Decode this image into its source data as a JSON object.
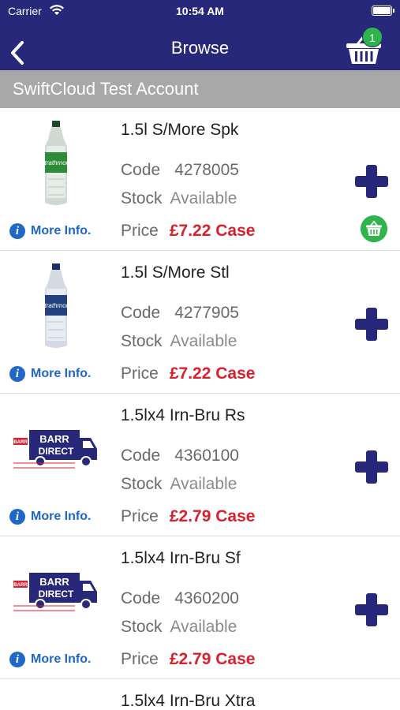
{
  "status_bar": {
    "carrier": "Carrier",
    "time": "10:54 AM"
  },
  "nav": {
    "title": "Browse",
    "basket_count": "1"
  },
  "account": {
    "name": "SwiftCloud Test Account"
  },
  "labels": {
    "code": "Code",
    "stock": "Stock",
    "price": "Price",
    "more_info": "More Info."
  },
  "products": [
    {
      "name": "1.5l S/More Spk",
      "code": "4278005",
      "stock": "Available",
      "price": "£7.22 Case",
      "image": "sparkling-water-bottle",
      "in_basket": true
    },
    {
      "name": "1.5l S/More Stl",
      "code": "4277905",
      "stock": "Available",
      "price": "£7.22 Case",
      "image": "still-water-bottle",
      "in_basket": false
    },
    {
      "name": "1.5lx4 Irn-Bru Rs",
      "code": "4360100",
      "stock": "Available",
      "price": "£2.79 Case",
      "image": "barr-direct-van-logo",
      "in_basket": false
    },
    {
      "name": "1.5lx4 Irn-Bru Sf",
      "code": "4360200",
      "stock": "Available",
      "price": "£2.79 Case",
      "image": "barr-direct-van-logo",
      "in_basket": false
    },
    {
      "name": "1.5lx4 Irn-Bru Xtra"
    }
  ],
  "colors": {
    "nav_background": "#27287a",
    "account_bar": "#a8a8a8",
    "price_red": "#d9202f",
    "link_blue": "#1f67c8",
    "badge_green": "#2db44a"
  }
}
